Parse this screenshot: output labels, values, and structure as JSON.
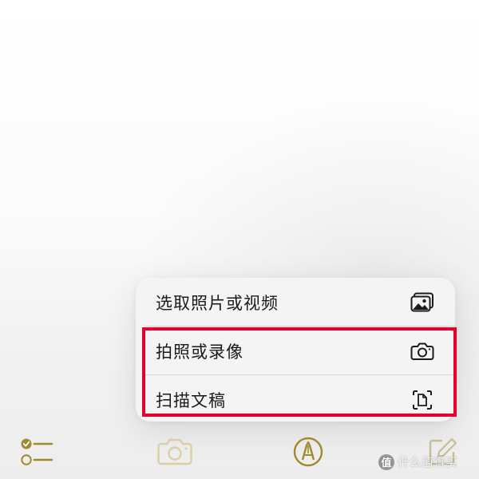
{
  "colors": {
    "accent": "#a08a2e",
    "highlight": "#e5002d",
    "menu_bg": "#f4f4f4",
    "text": "#1b1b1b"
  },
  "menu": {
    "items": [
      {
        "label": "选取照片或视频",
        "icon": "photo-library-icon"
      },
      {
        "label": "拍照或录像",
        "icon": "camera-icon"
      },
      {
        "label": "扫描文稿",
        "icon": "scan-document-icon"
      }
    ]
  },
  "toolbar": {
    "buttons": [
      {
        "name": "checklist",
        "icon": "checklist-icon"
      },
      {
        "name": "camera",
        "icon": "camera-icon",
        "state": "active"
      },
      {
        "name": "markup",
        "icon": "markup-pen-icon"
      },
      {
        "name": "compose",
        "icon": "compose-icon"
      }
    ]
  },
  "watermark": {
    "badge": "值",
    "text": "什么值得买"
  }
}
